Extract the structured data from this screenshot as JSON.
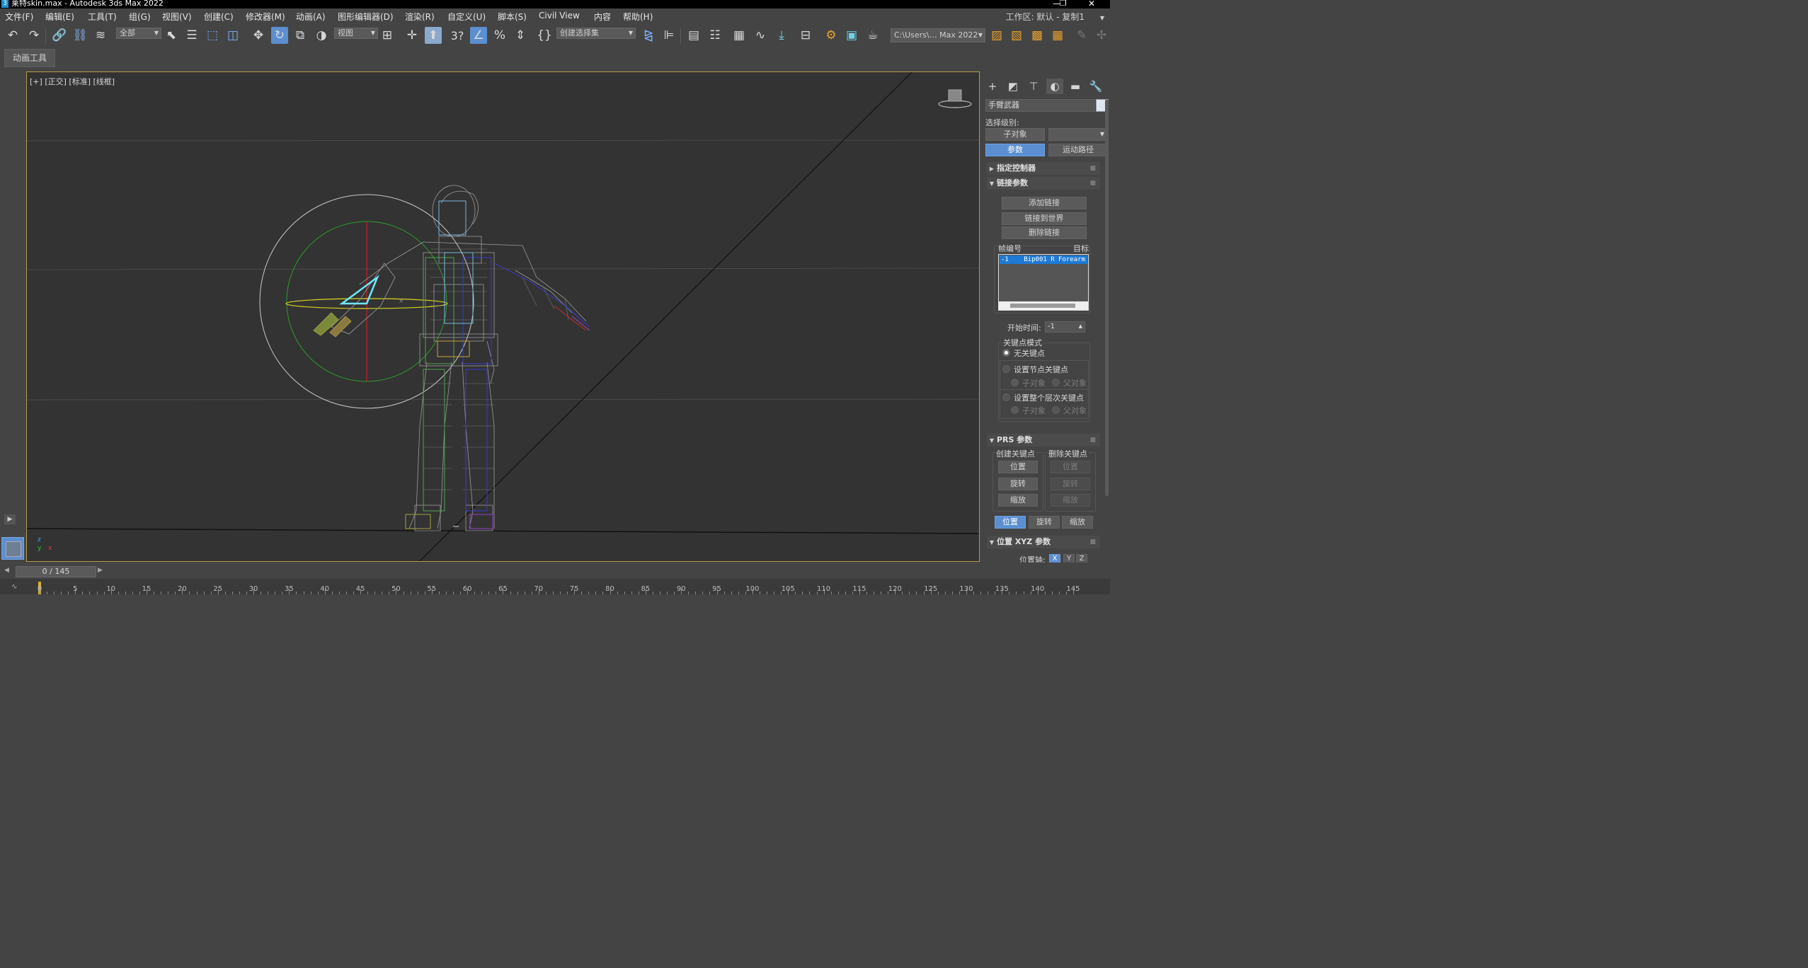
{
  "window": {
    "title": "莱特skin.max - Autodesk 3ds Max 2022",
    "logo_letter": "3"
  },
  "menu": {
    "items": [
      "文件(F)",
      "编辑(E)",
      "工具(T)",
      "组(G)",
      "视图(V)",
      "创建(C)",
      "修改器(M)",
      "动画(A)",
      "图形编辑器(D)",
      "渲染(R)",
      "自定义(U)",
      "脚本(S)",
      "Civil View",
      "内容",
      "帮助(H)"
    ],
    "workspace_label": "工作区:",
    "workspace_value": "默认 - 复制1"
  },
  "toolbar": {
    "selection_filter": "全部",
    "ref_coord": "视图",
    "named_selection": "创建选择集",
    "snap_label": "3",
    "project_path": "C:\\Users\\… Max 2022"
  },
  "secondary_toolbar": {
    "anim_tools": "动画工具"
  },
  "viewport": {
    "label_plus": "[+]",
    "label_view": "[正交]",
    "label_shading1": "[标准]",
    "label_shading2": "[线框]",
    "axis_labels": {
      "z": "z",
      "y": "y",
      "x": "x"
    }
  },
  "command_panel": {
    "object_name": "手臂武器",
    "selection_level_label": "选择级别:",
    "sub_object_button": "子对象",
    "params_button": "参数",
    "motion_path_button": "运动路径",
    "rollouts": {
      "assign_controller": "指定控制器",
      "link_params": "链接参数",
      "prs_params": "PRS 参数",
      "pos_xyz": "位置 XYZ 参数"
    },
    "link": {
      "add_link": "添加链接",
      "link_to_world": "链接到世界",
      "delete_link": "删除链接",
      "frame_label": "帧编号",
      "target_label": "目标",
      "list_item_frame": "-1",
      "list_item_target": "Bip001 R Forearm",
      "start_time_label": "开始时间:",
      "start_time_value": "-1",
      "key_mode_label": "关键点模式",
      "no_key": "无关键点",
      "set_node_keys": "设置节点关键点",
      "child": "子对象",
      "parent": "父对象",
      "set_hier_keys": "设置整个层次关键点",
      "child2": "子对象",
      "parent2": "父对象"
    },
    "prs": {
      "create_key_label": "创建关键点",
      "delete_key_label": "删除关键点",
      "position": "位置",
      "rotation": "旋转",
      "scale": "缩放",
      "del_position": "位置",
      "del_rotation": "旋转",
      "del_scale": "缩放",
      "tab_position": "位置",
      "tab_rotation": "旋转",
      "tab_scale": "缩放"
    },
    "pos_xyz": {
      "axis_label": "位置轴:",
      "x": "X",
      "y": "Y",
      "z": "Z"
    }
  },
  "timeline": {
    "current": "0 / 145",
    "ruler": [
      0,
      5,
      10,
      15,
      20,
      25,
      30,
      35,
      40,
      45,
      50,
      55,
      60,
      65,
      70,
      75,
      80,
      85,
      90,
      95,
      100,
      105,
      110,
      115,
      120,
      125,
      130,
      135,
      140,
      145
    ]
  },
  "colors": {
    "accent": "#5b8fd1",
    "viewport_border": "#b59a43",
    "selection_cyan": "#6ee6ff"
  }
}
